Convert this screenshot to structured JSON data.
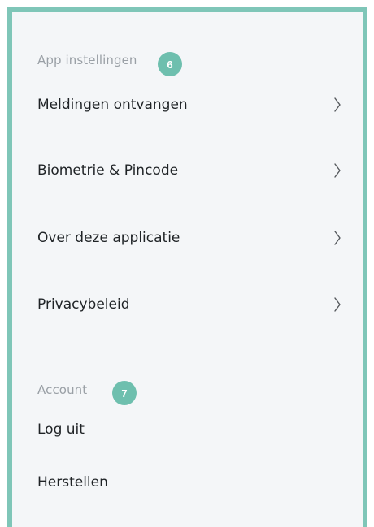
{
  "app_settings": {
    "label": "App instellingen",
    "badge": "6",
    "items": [
      {
        "label": "Meldingen ontvangen",
        "icon": "chevron-right-icon"
      },
      {
        "label": "Biometrie & Pincode",
        "icon": "chevron-right-icon"
      },
      {
        "label": "Over deze applicatie",
        "icon": "chevron-right-icon"
      },
      {
        "label": "Privacybeleid",
        "icon": "chevron-right-icon"
      }
    ]
  },
  "account": {
    "label": "Account",
    "badge": "7",
    "items": [
      {
        "label": "Log uit"
      },
      {
        "label": "Herstellen"
      }
    ]
  },
  "colors": {
    "frame_border": "#7fc6b8",
    "badge": "#6ebfae",
    "background": "#f4f6f8",
    "section_label": "#9aa0a6",
    "item_text": "#1f2326"
  }
}
